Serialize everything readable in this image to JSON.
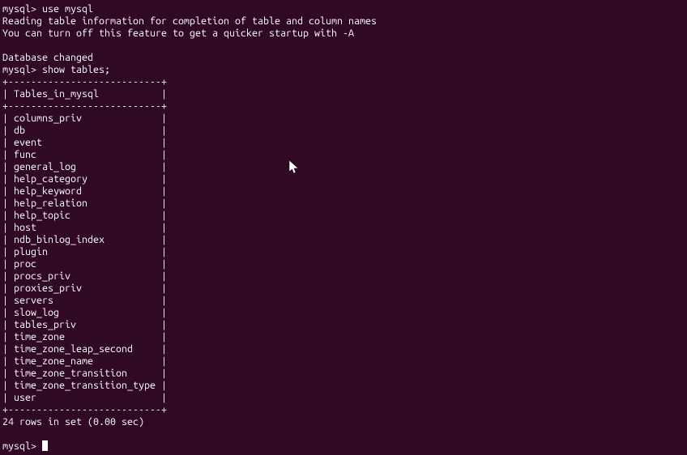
{
  "prompt": "mysql>",
  "cmd_use": "use mysql",
  "info_line1": "Reading table information for completion of table and column names",
  "info_line2": "You can turn off this feature to get a quicker startup with -A",
  "db_changed": "Database changed",
  "cmd_show": "show tables;",
  "border": "+---------------------------+",
  "header": "| Tables_in_mysql           |",
  "rows": [
    "| columns_priv              |",
    "| db                        |",
    "| event                     |",
    "| func                      |",
    "| general_log               |",
    "| help_category             |",
    "| help_keyword              |",
    "| help_relation             |",
    "| help_topic                |",
    "| host                      |",
    "| ndb_binlog_index          |",
    "| plugin                    |",
    "| proc                      |",
    "| procs_priv                |",
    "| proxies_priv              |",
    "| servers                   |",
    "| slow_log                  |",
    "| tables_priv               |",
    "| time_zone                 |",
    "| time_zone_leap_second     |",
    "| time_zone_name            |",
    "| time_zone_transition      |",
    "| time_zone_transition_type |",
    "| user                      |"
  ],
  "summary": "24 rows in set (0.00 sec)"
}
